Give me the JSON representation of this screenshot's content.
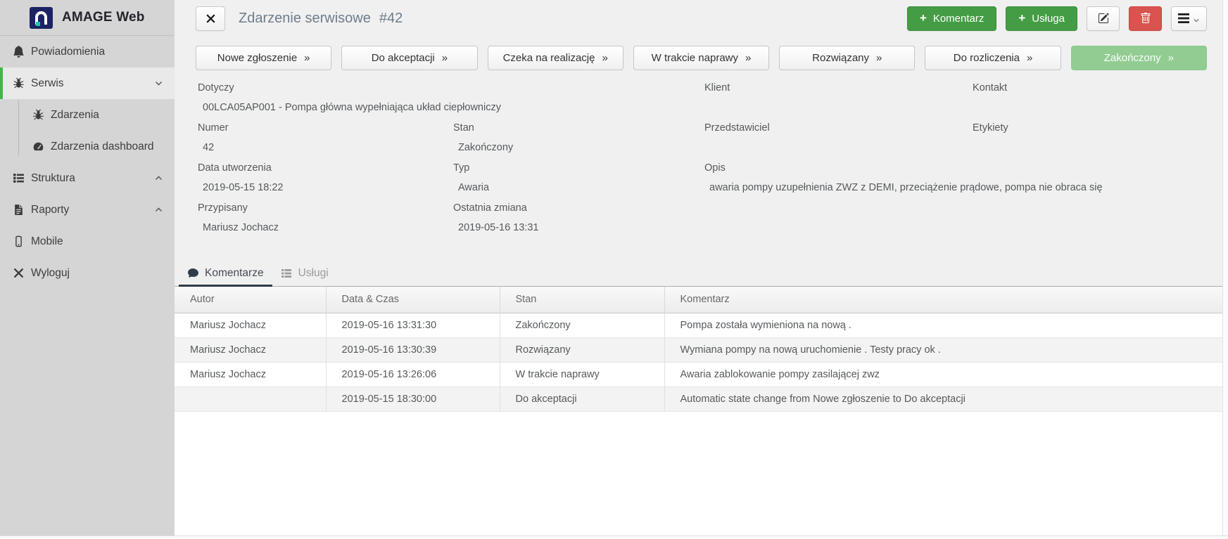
{
  "brand": {
    "name": "AMAGE Web"
  },
  "sidebar": {
    "items": [
      {
        "label": "Powiadomienia"
      },
      {
        "label": "Serwis"
      },
      {
        "label": "Zdarzenia"
      },
      {
        "label": "Zdarzenia dashboard"
      },
      {
        "label": "Struktura"
      },
      {
        "label": "Raporty"
      },
      {
        "label": "Mobile"
      },
      {
        "label": "Wyloguj"
      }
    ]
  },
  "header": {
    "title": "Zdarzenie serwisowe",
    "number": "#42",
    "actions": {
      "plus": "+",
      "add_comment": "Komentarz",
      "add_service": "Usługa"
    }
  },
  "workflow": {
    "arrow": "»",
    "states": [
      {
        "label": "Nowe zgłoszenie"
      },
      {
        "label": "Do akceptacji"
      },
      {
        "label": "Czeka na realizację"
      },
      {
        "label": "W trakcie naprawy"
      },
      {
        "label": "Rozwiązany"
      },
      {
        "label": "Do rozliczenia"
      },
      {
        "label": "Zakończony",
        "current": true
      }
    ]
  },
  "details": {
    "dotyczy": {
      "label": "Dotyczy",
      "value": "00LCA05AP001 - Pompa główna wypełniająca układ ciepłowniczy"
    },
    "klient": {
      "label": "Klient",
      "value": ""
    },
    "kontakt": {
      "label": "Kontakt",
      "value": ""
    },
    "numer": {
      "label": "Numer",
      "value": "42"
    },
    "stan": {
      "label": "Stan",
      "value": "Zakończony"
    },
    "przedstawiciel": {
      "label": "Przedstawiciel",
      "value": ""
    },
    "etykiety": {
      "label": "Etykiety",
      "value": ""
    },
    "data_utworzenia": {
      "label": "Data utworzenia",
      "value": "2019-05-15 18:22"
    },
    "typ": {
      "label": "Typ",
      "value": "Awaria"
    },
    "opis": {
      "label": "Opis",
      "value": "awaria pompy uzupełnienia ZWZ z DEMI, przeciążenie prądowe, pompa nie obraca się"
    },
    "przypisany": {
      "label": "Przypisany",
      "value": "Mariusz Jochacz"
    },
    "ostatnia_zmiana": {
      "label": "Ostatnia zmiana",
      "value": "2019-05-16 13:31"
    }
  },
  "tabs": [
    {
      "label": "Komentarze"
    },
    {
      "label": "Usługi"
    }
  ],
  "comments": {
    "columns": [
      "Autor",
      "Data & Czas",
      "Stan",
      "Komentarz"
    ],
    "rows": [
      {
        "autor": "Mariusz Jochacz",
        "czas": "2019-05-16 13:31:30",
        "stan": "Zakończony",
        "komentarz": "Pompa została wymieniona na nową ."
      },
      {
        "autor": "Mariusz Jochacz",
        "czas": "2019-05-16 13:30:39",
        "stan": "Rozwiązany",
        "komentarz": "Wymiana pompy na nową uruchomienie . Testy pracy ok ."
      },
      {
        "autor": "Mariusz Jochacz",
        "czas": "2019-05-16 13:26:06",
        "stan": "W trakcie naprawy",
        "komentarz": "Awaria zablokowanie pompy zasilającej zwz"
      },
      {
        "autor": "",
        "czas": "2019-05-15 18:30:00",
        "stan": "Do akceptacji",
        "komentarz": "Automatic state change from Nowe zgłoszenie to Do akceptacji"
      }
    ]
  },
  "colors": {
    "accent_green": "#43b549",
    "button_green": "#449d44",
    "button_red": "#d9534f",
    "current_state_green": "#92cc92",
    "sidebar_bg": "#d5d5d5",
    "page_bg": "#f0f0f0"
  }
}
